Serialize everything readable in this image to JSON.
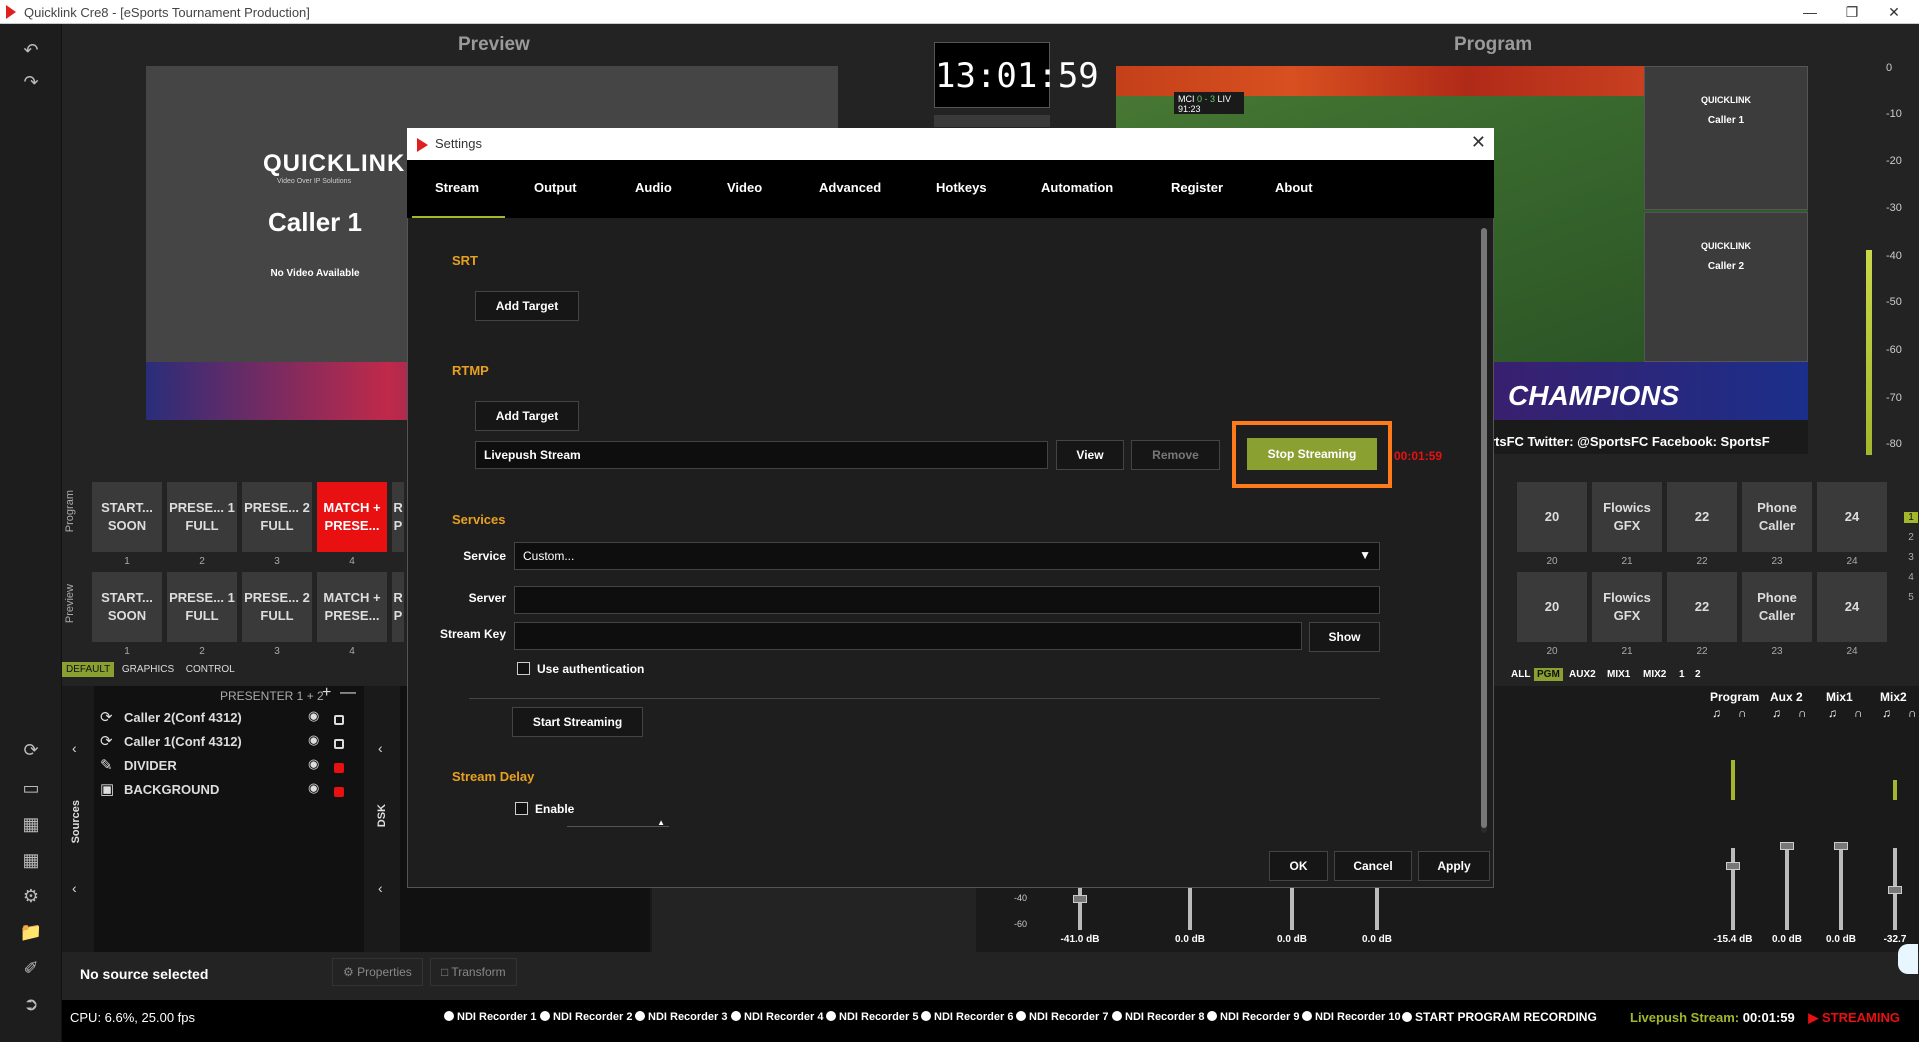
{
  "window": {
    "title": "Quicklink Cre8 - [eSports Tournament Production]"
  },
  "preview": {
    "label": "Preview",
    "brand": "QUICKLINK",
    "brand_tagline": "Video Over IP Solutions",
    "caller": "Caller 1",
    "no_video": "No Video Available"
  },
  "program": {
    "label": "Program",
    "clock": "13:01:59",
    "score": {
      "home": "MCI",
      "score": "0 - 3",
      "away": "LIV",
      "time": "91:23"
    },
    "tile_brand": "QUICKLINK",
    "tiles": [
      "Caller 1",
      "Caller 2"
    ],
    "banner": "CHAMPIONS",
    "ticker": "rtsFC   Twitter: @SportsFC   Facebook: SportsF"
  },
  "meter_ticks": [
    "0",
    "-10",
    "-20",
    "-30",
    "-40",
    "-50",
    "-60",
    "-70",
    "-80"
  ],
  "rows": {
    "program_label": "Program",
    "preview_label": "Preview",
    "left_presets": [
      "START... SOON",
      "PRESE... 1 FULL",
      "PRESE... 2 FULL",
      "MATCH + PRESE...",
      "R P"
    ],
    "left_numbers": [
      "1",
      "2",
      "3",
      "4"
    ],
    "right_presets": [
      "20",
      "Flowics GFX",
      "22",
      "Phone Caller",
      "24"
    ],
    "right_numbers": [
      "20",
      "21",
      "22",
      "23",
      "24"
    ],
    "side_numbers": [
      "1",
      "2",
      "3",
      "4",
      "5"
    ]
  },
  "tabs": [
    "DEFAULT",
    "GRAPHICS",
    "CONTROL"
  ],
  "sources": {
    "title": "PRESENTER 1 + 2",
    "vertical_label": "Sources",
    "dsk_label": "DSK",
    "items": [
      {
        "name": "Caller 2(Conf 4312)",
        "icon": "quicklink-icon"
      },
      {
        "name": "Caller 1(Conf 4312)",
        "icon": "quicklink-icon"
      },
      {
        "name": "DIVIDER",
        "icon": "brush-icon"
      },
      {
        "name": "BACKGROUND",
        "icon": "image-icon"
      }
    ]
  },
  "mixer": {
    "filters": [
      "ALL",
      "PGM",
      "AUX2",
      "MIX1",
      "MIX2",
      "1",
      "2"
    ],
    "channels": [
      "Program",
      "Aux 2",
      "Mix1",
      "Mix2"
    ],
    "db_left": [
      "-41.0 dB",
      "0.0 dB",
      "0.0 dB",
      "0.0 dB"
    ],
    "db_right": [
      "-15.4 dB",
      "0.0 dB",
      "0.0 dB",
      "-32.7"
    ],
    "scale": [
      "-40",
      "-60"
    ]
  },
  "bottom": {
    "no_source": "No source selected",
    "properties": "Properties",
    "transform": "Transform",
    "cpu": "CPU: 6.6%, 25.00 fps",
    "recorders": [
      "NDI Recorder 1",
      "NDI Recorder 2",
      "NDI Recorder 3",
      "NDI Recorder 4",
      "NDI Recorder 5",
      "NDI Recorder 6",
      "NDI Recorder 7",
      "NDI Recorder 8",
      "NDI Recorder 9",
      "NDI Recorder 10"
    ],
    "start_recording": "START PROGRAM RECORDING",
    "stream_label": "Livepush Stream:",
    "stream_time": "00:01:59",
    "streaming": "STREAMING"
  },
  "settings": {
    "title": "Settings",
    "tabs": [
      "Stream",
      "Output",
      "Audio",
      "Video",
      "Advanced",
      "Hotkeys",
      "Automation",
      "Register",
      "About"
    ],
    "srt_label": "SRT",
    "rtmp_label": "RTMP",
    "add_target": "Add Target",
    "target_name": "Livepush Stream",
    "view": "View",
    "remove": "Remove",
    "stop_streaming": "Stop Streaming",
    "stream_time": "00:01:59",
    "services_label": "Services",
    "service_label": "Service",
    "service_value": "Custom...",
    "server_label": "Server",
    "server_value": "",
    "stream_key_label": "Stream Key",
    "stream_key_value": "",
    "show": "Show",
    "use_auth": "Use authentication",
    "start_streaming": "Start Streaming",
    "delay_label": "Stream Delay",
    "enable": "Enable",
    "ok": "OK",
    "cancel": "Cancel",
    "apply": "Apply"
  },
  "colors": {
    "accent": "#a3b62c",
    "orange": "#ff7a1a",
    "red": "#e81010",
    "section": "#e8a020"
  }
}
